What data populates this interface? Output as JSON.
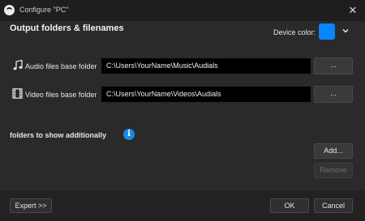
{
  "window": {
    "title": "Configure \"PC\"",
    "close_glyph": "✕"
  },
  "header": {
    "heading": "Output folders & filenames",
    "device_color_label": "Device color:",
    "device_color": "#0a84ff"
  },
  "audio": {
    "label": "Audio files base folder",
    "path": "C:\\Users\\YourName\\Music\\Audials",
    "browse_label": "..."
  },
  "video": {
    "label": "Video files base folder",
    "path": "C:\\Users\\YourName\\Videos\\Audials",
    "browse_label": "..."
  },
  "additional": {
    "label": "folders to show additionally",
    "info_glyph": "i",
    "add_label": "Add...",
    "remove_label": "Remove"
  },
  "footer": {
    "expert_label": "Expert >>",
    "ok_label": "OK",
    "cancel_label": "Cancel"
  }
}
